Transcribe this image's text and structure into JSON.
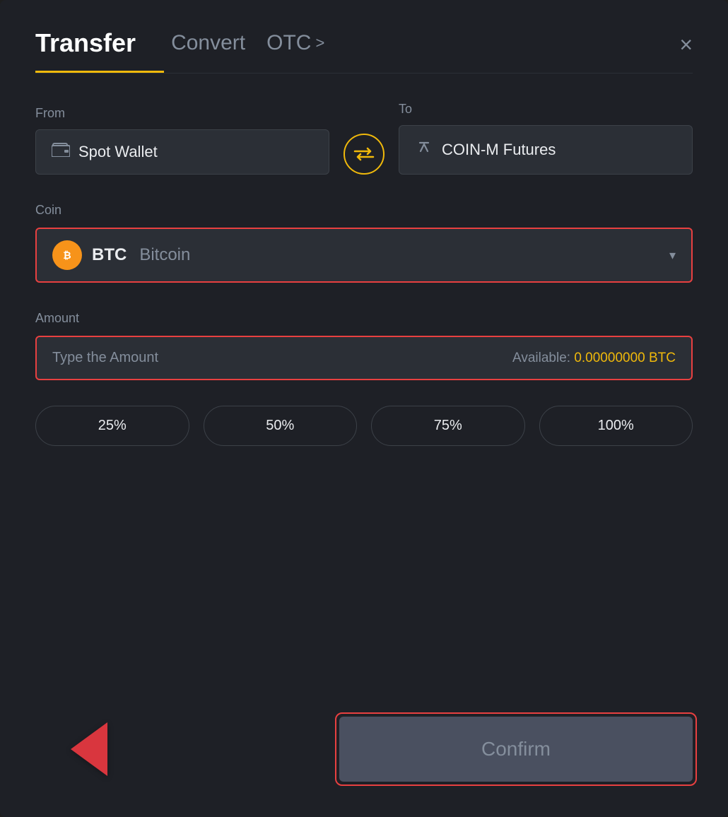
{
  "header": {
    "tab_transfer": "Transfer",
    "tab_convert": "Convert",
    "tab_otc": "OTC",
    "tab_otc_chevron": ">",
    "close_label": "×"
  },
  "from_section": {
    "label": "From",
    "wallet_name": "Spot Wallet"
  },
  "to_section": {
    "label": "To",
    "wallet_name": "COIN-M Futures"
  },
  "coin_section": {
    "label": "Coin",
    "coin_symbol": "BTC",
    "coin_name": "Bitcoin",
    "coin_icon": "₿"
  },
  "amount_section": {
    "label": "Amount",
    "placeholder": "Type the Amount",
    "available_label": "Available:",
    "available_value": "0.00000000 BTC"
  },
  "pct_buttons": [
    "25%",
    "50%",
    "75%",
    "100%"
  ],
  "confirm_button": {
    "label": "Confirm"
  },
  "icons": {
    "swap": "⇄",
    "wallet": "💳",
    "futures": "↑",
    "chevron_down": "▾"
  }
}
